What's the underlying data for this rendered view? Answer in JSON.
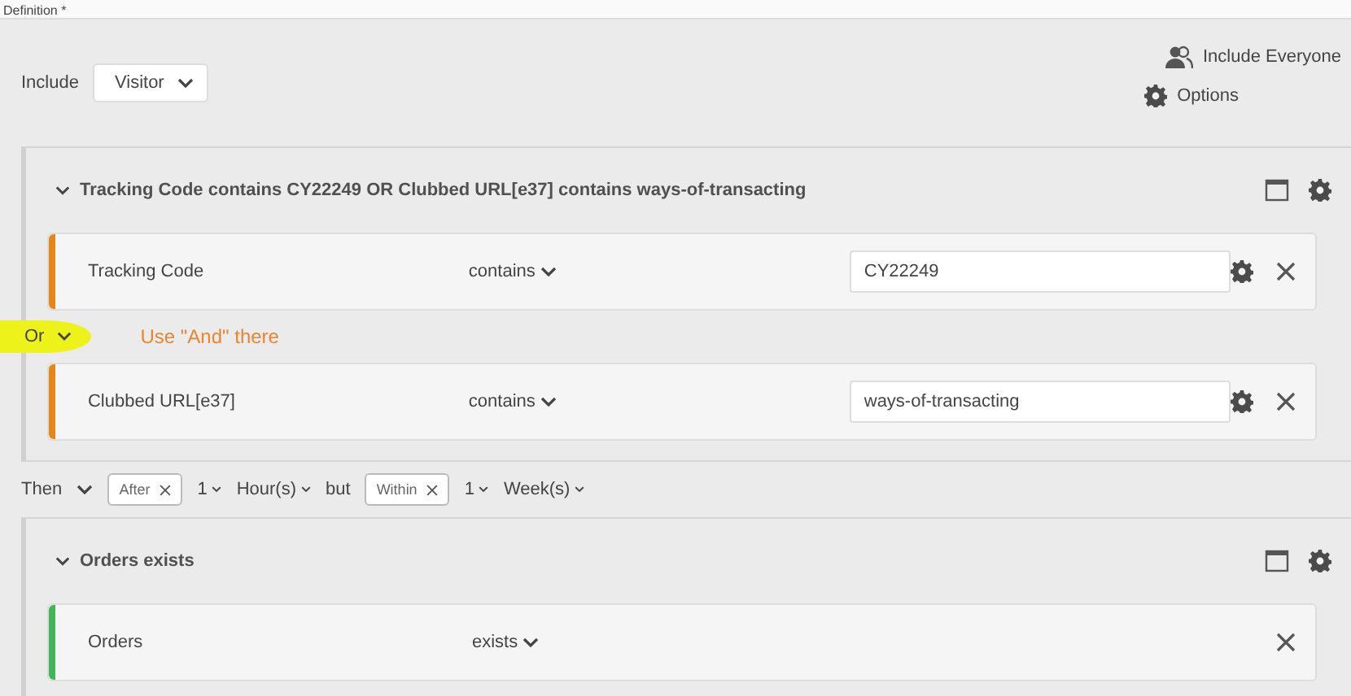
{
  "header": {
    "title": "Definition *"
  },
  "include": {
    "label": "Include",
    "value": "Visitor"
  },
  "actions": [
    {
      "kind": "people",
      "label": "Include Everyone"
    },
    {
      "kind": "gear",
      "label": "Options"
    }
  ],
  "containers": [
    {
      "title": "Tracking Code contains CY22249 OR Clubbed URL[e37] contains ways-of-transacting",
      "expanded": true,
      "color": "#e68619",
      "rules": [
        {
          "kind": "match",
          "dimension": "Tracking Code",
          "operator": "contains",
          "value": "CY22249"
        },
        {
          "kind": "match",
          "dimension": "Clubbed URL[e37]",
          "operator": "contains",
          "value": "ways-of-transacting"
        }
      ],
      "joiner": {
        "label": "Or",
        "highlighted": true,
        "note": "Use \"And\" there"
      }
    },
    {
      "title": "Orders exists",
      "expanded": true,
      "color": "#44b556",
      "rules": [
        {
          "kind": "exists",
          "dimension": "Orders",
          "operator": "exists"
        }
      ]
    }
  ],
  "sequence": {
    "operator": "Then",
    "after": {
      "label": "After",
      "count": "1",
      "unit": "Hour(s)"
    },
    "but": "but",
    "within": {
      "label": "Within",
      "count": "1",
      "unit": "Week(s)"
    }
  }
}
